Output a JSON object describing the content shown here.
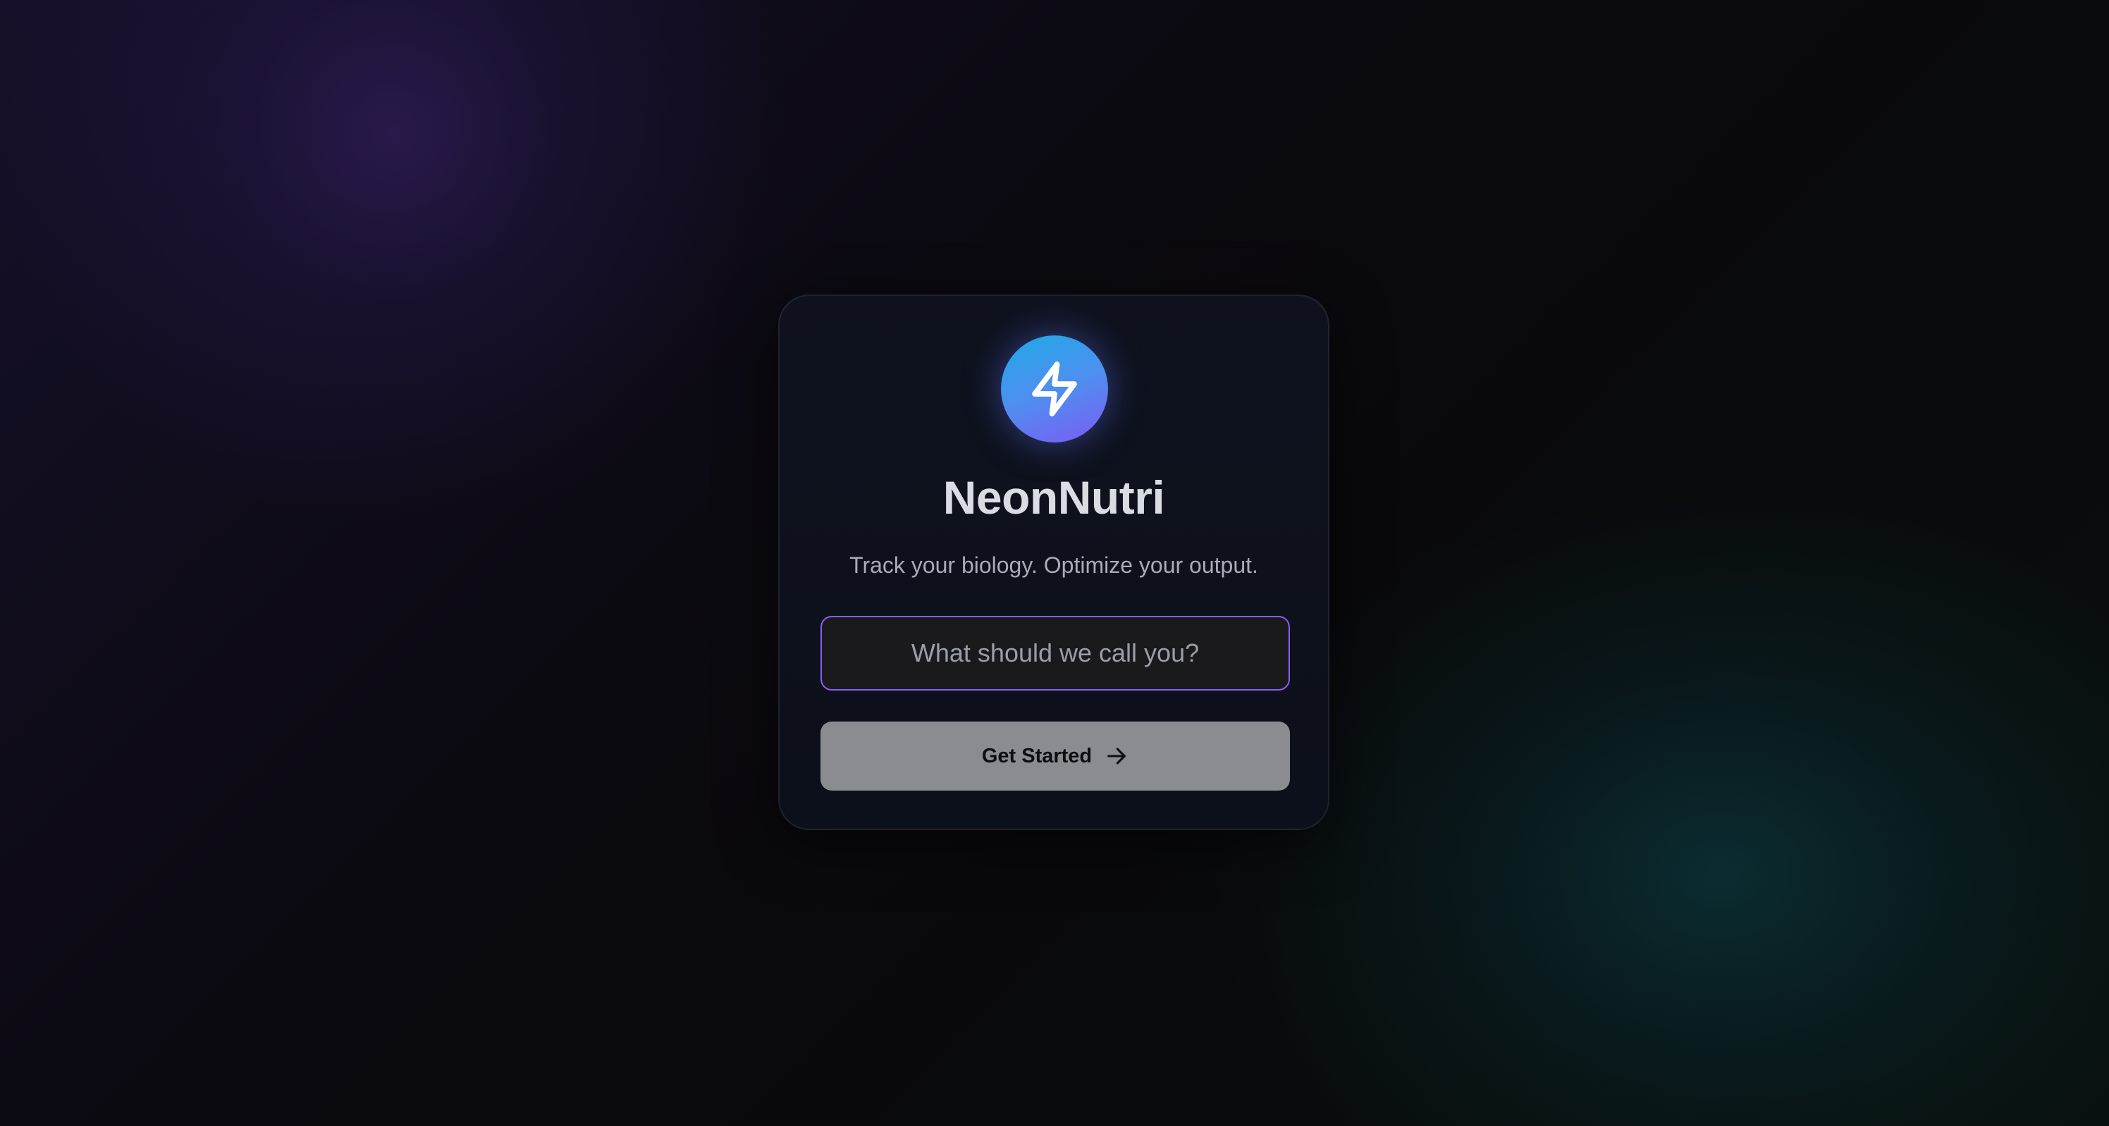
{
  "app": {
    "title": "NeonNutri",
    "tagline": "Track your biology. Optimize your output."
  },
  "logo": {
    "icon": "lightning-bolt-icon"
  },
  "name_input": {
    "placeholder": "What should we call you?",
    "value": ""
  },
  "start_button": {
    "label": "Get Started",
    "icon": "arrow-right-icon"
  },
  "colors": {
    "accent_purple": "#8b5cf6",
    "logo_gradient_start": "#1fa9e6",
    "logo_gradient_end": "#7b5cf4",
    "button_bg": "#8a8c91"
  }
}
